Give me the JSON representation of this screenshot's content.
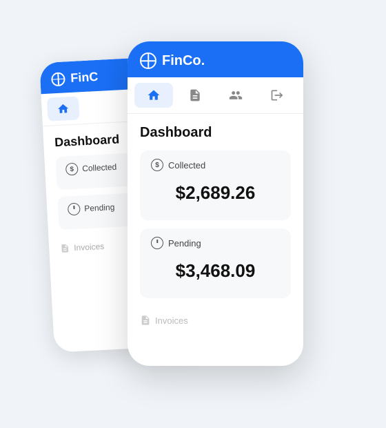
{
  "app": {
    "name": "FinCo.",
    "brand_color": "#1a6ff5"
  },
  "nav": {
    "items": [
      {
        "id": "home",
        "label": "Home",
        "active": true
      },
      {
        "id": "documents",
        "label": "Documents",
        "active": false
      },
      {
        "id": "users",
        "label": "Users",
        "active": false
      },
      {
        "id": "logout",
        "label": "Logout",
        "active": false
      }
    ]
  },
  "dashboard": {
    "title": "Dashboard",
    "collected": {
      "label": "Collected",
      "value": "$2,689.26"
    },
    "pending": {
      "label": "Pending",
      "value": "$3,468.09"
    },
    "invoices": {
      "label": "Invoices"
    }
  }
}
